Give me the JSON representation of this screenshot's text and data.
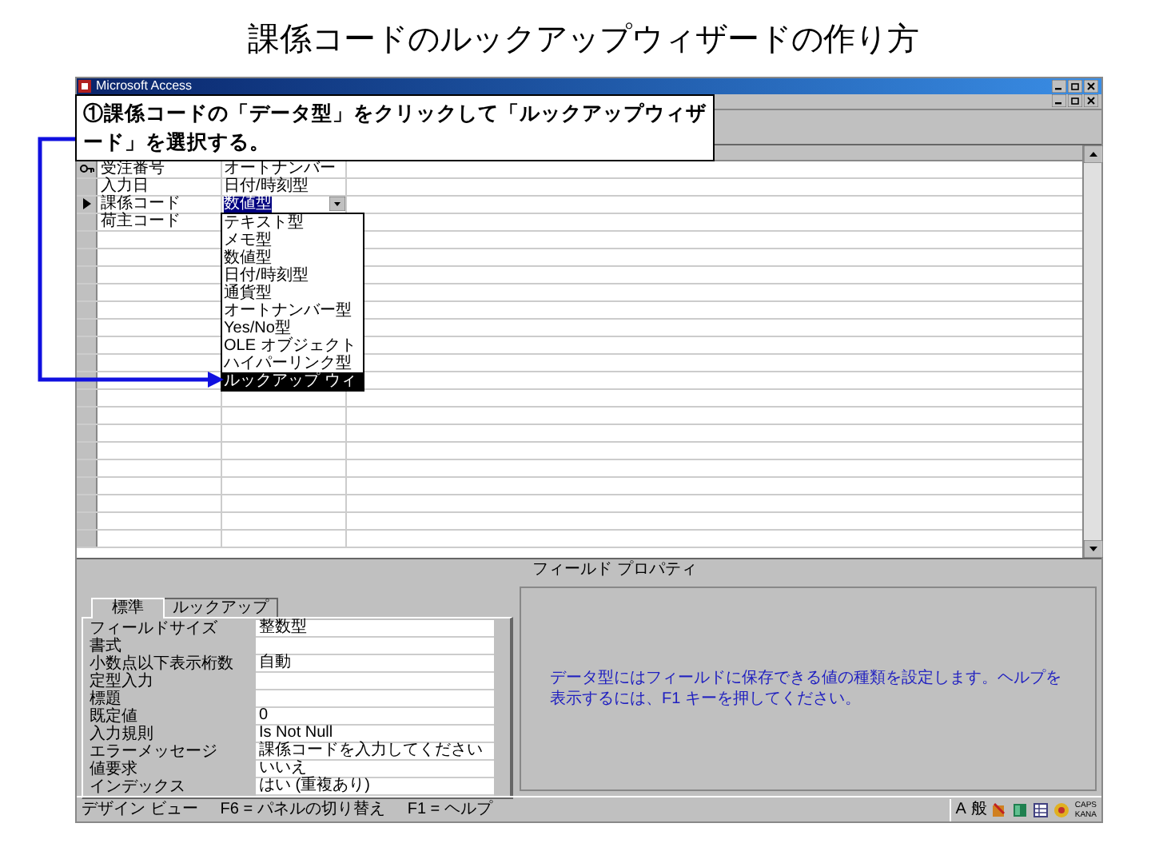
{
  "page_title": "課係コードのルックアップウィザードの作り方",
  "window": {
    "title": "Microsoft Access"
  },
  "callout": {
    "text": "①課係コードの「データ型」をクリックして「ルックアップウィザード」を選択する。"
  },
  "table_design": {
    "rows": [
      {
        "name": "受注番号",
        "type": "オートナンバー",
        "primary_key": true,
        "current": false
      },
      {
        "name": "入力日",
        "type": "日付/時刻型",
        "primary_key": false,
        "current": false
      },
      {
        "name": "課係コード",
        "type": "数値型",
        "primary_key": false,
        "current": true
      },
      {
        "name": "荷主コード",
        "primary_key": false,
        "current": false
      }
    ]
  },
  "type_dropdown": {
    "items": [
      {
        "label": "テキスト型",
        "selected": false
      },
      {
        "label": "メモ型",
        "selected": false
      },
      {
        "label": "数値型",
        "selected": false
      },
      {
        "label": "日付/時刻型",
        "selected": false
      },
      {
        "label": "通貨型",
        "selected": false
      },
      {
        "label": "オートナンバー型",
        "selected": false
      },
      {
        "label": "Yes/No型",
        "selected": false
      },
      {
        "label": "OLE オブジェクト",
        "selected": false
      },
      {
        "label": "ハイパーリンク型",
        "selected": false
      },
      {
        "label": "ルックアップ ウィ",
        "selected": true
      }
    ]
  },
  "properties_pane": {
    "title": "フィールド プロパティ",
    "tabs": [
      {
        "label": "標準",
        "selected": true
      },
      {
        "label": "ルックアップ",
        "selected": false
      }
    ],
    "properties": [
      {
        "label": "フィールドサイズ",
        "value": "整数型"
      },
      {
        "label": "書式"
      },
      {
        "label": "小数点以下表示桁数",
        "value": "自動"
      },
      {
        "label": "定型入力"
      },
      {
        "label": "標題"
      },
      {
        "label": "既定値",
        "value": "0"
      },
      {
        "label": "入力規則",
        "value": "Is Not Null"
      },
      {
        "label": "エラーメッセージ",
        "value": "課係コードを入力してください"
      },
      {
        "label": "値要求",
        "value": "いいえ"
      },
      {
        "label": "インデックス",
        "value": "はい (重複あり)"
      }
    ],
    "help_text": "データ型にはフィールドに保存できる値の種類を設定します。ヘルプを表示するには、F1 キーを押してください。"
  },
  "status_bar": {
    "items": [
      "デザイン ビュー",
      "F6 = パネルの切り替え",
      "F1 = ヘルプ"
    ],
    "tray": [
      "A",
      "般"
    ],
    "indicators": [
      "CAPS",
      "KANA"
    ]
  }
}
